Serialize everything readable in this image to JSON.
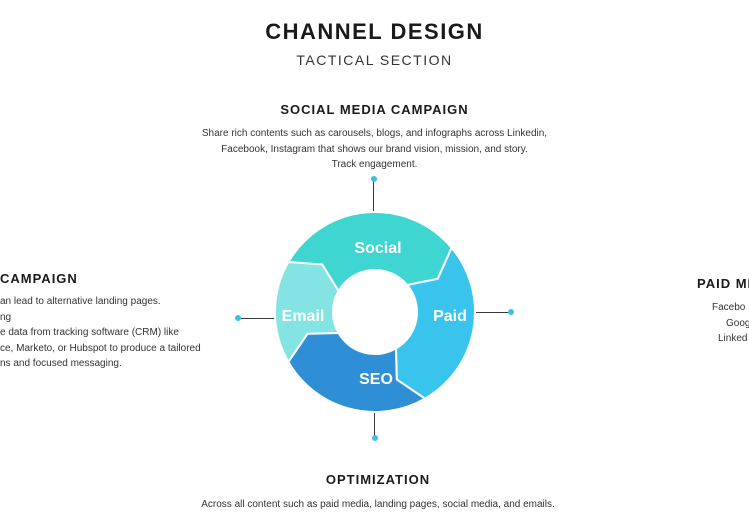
{
  "header": {
    "title": "CHANNEL DESIGN",
    "subtitle": "TACTICAL SECTION"
  },
  "social": {
    "heading": "SOCIAL MEDIA CAMPAIGN",
    "lines": [
      "Share rich contents such as carousels, blogs, and infographs across Linkedin,",
      "Facebook, Instagram that shows our brand vision, mission, and story.",
      "Track engagement."
    ]
  },
  "email": {
    "heading": "CAMPAIGN",
    "lines": [
      "an lead to alternative landing pages.",
      "ng",
      "e data from tracking software (CRM) like",
      "ce, Marketo, or Hubspot to produce a tailored",
      "ns and focused messaging."
    ]
  },
  "paid": {
    "heading": "PAID MI",
    "lines": [
      "Facebo",
      "Goog",
      "Linked"
    ]
  },
  "optimization": {
    "heading": "OPTIMIZATION",
    "lines": [
      "Across all content such as paid media, landing pages, social media, and emails."
    ]
  },
  "wheel": {
    "segments": [
      {
        "label": "Social",
        "color": "#3fd6d1"
      },
      {
        "label": "Paid",
        "color": "#38c4ec"
      },
      {
        "label": "SEO",
        "color": "#2f8fd6"
      },
      {
        "label": "Email",
        "color": "#84e3e3"
      }
    ],
    "dot_color": "#3cc0e8"
  }
}
